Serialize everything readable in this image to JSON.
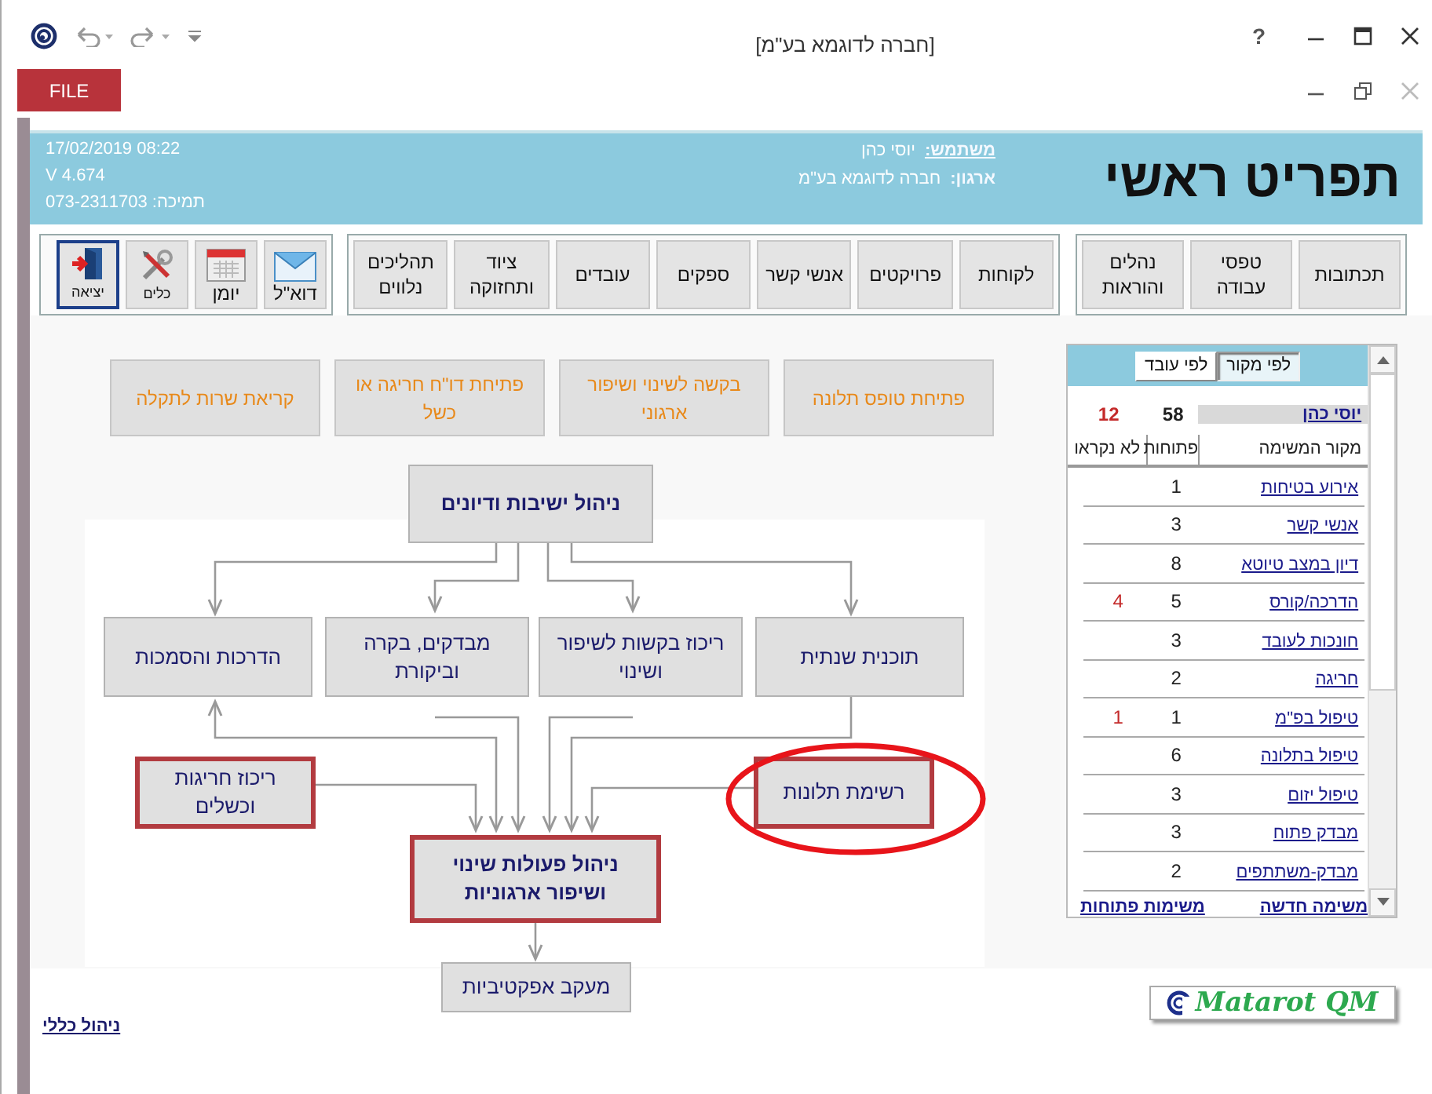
{
  "window": {
    "title": "[חברה לדוגמא בע\"מ]",
    "help": "?"
  },
  "ribbon": {
    "file_tab": "FILE"
  },
  "header": {
    "title": "תפריט ראשי",
    "user_label": "משתמש:",
    "user": "יוסי כהן",
    "org_label": "ארגון:",
    "org": "חברה לדוגמא בע\"מ",
    "datetime": "17/02/2019 08:22",
    "version": "V 4.674",
    "support": "תמיכה: 073-2311703"
  },
  "toolbar": {
    "forms_group": [
      "תכתובות",
      "טפסי עבודה",
      "נהלים והוראות"
    ],
    "records_group": [
      "לקוחות",
      "פרויקטים",
      "אנשי קשר",
      "ספקים",
      "עובדים",
      "ציוד ותחזוקה",
      "תהליכים נלווים"
    ],
    "tool_buttons": [
      {
        "kind": "mail",
        "label": "דוא\"ל"
      },
      {
        "kind": "calendar",
        "label": "יומן"
      },
      {
        "kind": "tools",
        "label": "כלים"
      },
      {
        "kind": "exit",
        "label": "יציאה"
      }
    ]
  },
  "quick_actions": [
    "פתיחת טופס תלונה",
    "בקשה לשינוי ושיפור ארגוני",
    "פתיחת דו\"ח חריגה או כשל",
    "קריאת שרות לתקלה"
  ],
  "diagram": {
    "nodes": [
      {
        "kind": "hub",
        "label": "ניהול ישיבות ודיונים"
      },
      {
        "kind": "step",
        "label": "תוכנית שנתית"
      },
      {
        "kind": "step",
        "label": "ריכוז בקשות לשיפור ושינוי"
      },
      {
        "kind": "step",
        "label": "מבדקים, בקרה וביקורת"
      },
      {
        "kind": "step",
        "label": "הדרכות והסמכות"
      },
      {
        "kind": "input",
        "label": "רשימת תלונות"
      },
      {
        "kind": "input",
        "label": "ריכוז חריגות וכשלים"
      },
      {
        "kind": "core",
        "label": "ניהול פעולות שינוי ושיפור ארגוניות"
      },
      {
        "kind": "step",
        "label": "מעקב אפקטיביות"
      }
    ]
  },
  "tasks_panel": {
    "modes": [
      {
        "label": "לפי מקור",
        "selected": true
      },
      {
        "label": "לפי עובד",
        "selected": false
      }
    ],
    "summary": {
      "name": "יוסי כהן",
      "open": "58",
      "unread": "12"
    },
    "columns": [
      "מקור המשימה",
      "פתוחות",
      "לא נקראו"
    ],
    "rows": [
      {
        "source": "אירוע בטיחות",
        "open": "1"
      },
      {
        "source": "אנשי קשר",
        "open": "3"
      },
      {
        "source": "דיון במצב טיוטא",
        "open": "8"
      },
      {
        "source": "הדרכה/קורס",
        "open": "5",
        "unread": "4"
      },
      {
        "source": "חונכות לעובד",
        "open": "3"
      },
      {
        "source": "חריגה",
        "open": "2"
      },
      {
        "source": "טיפול בפ\"מ",
        "open": "1",
        "unread": "1"
      },
      {
        "source": "טיפול בתלונה",
        "open": "6"
      },
      {
        "source": "טיפול יזום",
        "open": "3"
      },
      {
        "source": "מבדק פתוח",
        "open": "3"
      },
      {
        "source": "מבדק-משתתפים",
        "open": "2"
      }
    ],
    "links": [
      "משימה חדשה",
      "משימות פתוחות"
    ]
  },
  "footer": {
    "link": "ניהול כללי",
    "logo": "Matarot QM"
  }
}
